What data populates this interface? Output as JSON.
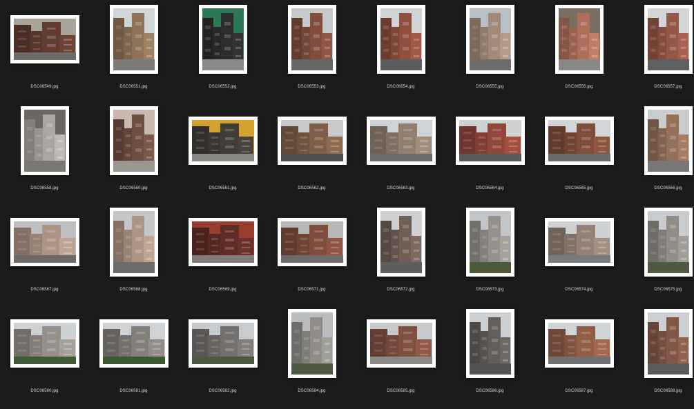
{
  "files": [
    {
      "name": "DSC06549.jpg",
      "orientation": "landscape",
      "sky": "#a9a39c",
      "bld": "#5e3a30",
      "road": "#6f6c67"
    },
    {
      "name": "DSC06551.jpg",
      "orientation": "portrait",
      "sky": "#cfd6d6",
      "bld": "#8a6e55",
      "road": "#7d7b77"
    },
    {
      "name": "DSC06552.jpg",
      "orientation": "portrait",
      "sky": "#2c7a55",
      "bld": "#2b2b2b",
      "road": "#8c8a86"
    },
    {
      "name": "DSC06553.jpg",
      "orientation": "portrait",
      "sky": "#c6cacb",
      "bld": "#7c4b3c",
      "road": "#676664"
    },
    {
      "name": "DSC06554.jpg",
      "orientation": "portrait",
      "sky": "#d0d2d3",
      "bld": "#8a4b3b",
      "road": "#5c5d5e"
    },
    {
      "name": "DSC06555.jpg",
      "orientation": "portrait",
      "sky": "#b9c0c5",
      "bld": "#9b8574",
      "road": "#6d6c6a"
    },
    {
      "name": "DSC06556.jpg",
      "orientation": "portrait",
      "sky": "#7b6e62",
      "bld": "#a66b57",
      "road": "#8b8782"
    },
    {
      "name": "DSC06557.jpg",
      "orientation": "portrait",
      "sky": "#d3d6d8",
      "bld": "#8f5444",
      "road": "#5f5f60"
    },
    {
      "name": "DSC06558.jpg",
      "orientation": "portrait",
      "sky": "#6e6660",
      "bld": "#a4a09b",
      "road": "#7b7874"
    },
    {
      "name": "DSC06560.jpg",
      "orientation": "portrait",
      "sky": "#c7b9b0",
      "bld": "#6b4a3f",
      "road": "#9a9690"
    },
    {
      "name": "DSC06561.jpg",
      "orientation": "landscape",
      "sky": "#d2a12f",
      "bld": "#3f3a35",
      "road": "#8a8782"
    },
    {
      "name": "DSC06562.jpg",
      "orientation": "landscape",
      "sky": "#c8c9ca",
      "bld": "#7a5b46",
      "road": "#4f4e4d"
    },
    {
      "name": "DSC06563.jpg",
      "orientation": "landscape",
      "sky": "#cfd3d6",
      "bld": "#8a7a6c",
      "road": "#6c6b6a"
    },
    {
      "name": "DSC06564.jpg",
      "orientation": "landscape",
      "sky": "#cfd1d2",
      "bld": "#8c4437",
      "road": "#5c5a58"
    },
    {
      "name": "DSC06565.jpg",
      "orientation": "landscape",
      "sky": "#d2d5d7",
      "bld": "#7a4a36",
      "road": "#6a6a6a"
    },
    {
      "name": "DSC06566.jpg",
      "orientation": "portrait",
      "sky": "#c9cbcc",
      "bld": "#8e6c55",
      "road": "#7a7875"
    },
    {
      "name": "DSC06567.jpg",
      "orientation": "landscape",
      "sky": "#bdbfc0",
      "bld": "#a48d80",
      "road": "#6c6a68"
    },
    {
      "name": "DSC06568.jpg",
      "orientation": "portrait",
      "sky": "#c4c6c7",
      "bld": "#a58f7f",
      "road": "#6e6c6a"
    },
    {
      "name": "DSC06569.jpg",
      "orientation": "landscape",
      "sky": "#9a3d2f",
      "bld": "#5b2b24",
      "road": "#7f7b77"
    },
    {
      "name": "DSC06571.jpg",
      "orientation": "landscape",
      "sky": "#b6b8b8",
      "bld": "#7b4a3a",
      "road": "#6b6a69"
    },
    {
      "name": "DSC06572.jpg",
      "orientation": "portrait",
      "sky": "#cfd1d2",
      "bld": "#6c5b52",
      "road": "#5e5e5e"
    },
    {
      "name": "DSC06573.jpg",
      "orientation": "portrait",
      "sky": "#c3c6c8",
      "bld": "#8f8c86",
      "road": "#4c5a3c"
    },
    {
      "name": "DSC06574.jpg",
      "orientation": "landscape",
      "sky": "#cfd2d4",
      "bld": "#8c7c70",
      "road": "#7a7a7a"
    },
    {
      "name": "DSC06575.jpg",
      "orientation": "portrait",
      "sky": "#c9ccce",
      "bld": "#8c8781",
      "road": "#4f5a44"
    },
    {
      "name": "DSC06580.jpg",
      "orientation": "landscape",
      "sky": "#cfd2d4",
      "bld": "#8f8a84",
      "road": "#3f5a34"
    },
    {
      "name": "DSC06581.jpg",
      "orientation": "landscape",
      "sky": "#d0d3d5",
      "bld": "#7e7b77",
      "road": "#3c5932"
    },
    {
      "name": "DSC06582.jpg",
      "orientation": "landscape",
      "sky": "#c8cbcd",
      "bld": "#6f6c69",
      "road": "#4b5a3c"
    },
    {
      "name": "DSC06584.jpg",
      "orientation": "portrait",
      "sky": "#b9bdc0",
      "bld": "#8a8884",
      "road": "#4d5a40"
    },
    {
      "name": "DSC06585.jpg",
      "orientation": "landscape",
      "sky": "#c7c9cb",
      "bld": "#7d4d3e",
      "road": "#8c8a87"
    },
    {
      "name": "DSC06586.jpg",
      "orientation": "portrait",
      "sky": "#cdd0d2",
      "bld": "#5f5a56",
      "road": "#525454"
    },
    {
      "name": "DSC06587.jpg",
      "orientation": "landscape",
      "sky": "#d1d4d6",
      "bld": "#8c5a45",
      "road": "#707070"
    },
    {
      "name": "DSC06588.jpg",
      "orientation": "portrait",
      "sky": "#cdd0d2",
      "bld": "#7e5444",
      "road": "#5e5d5c"
    }
  ]
}
